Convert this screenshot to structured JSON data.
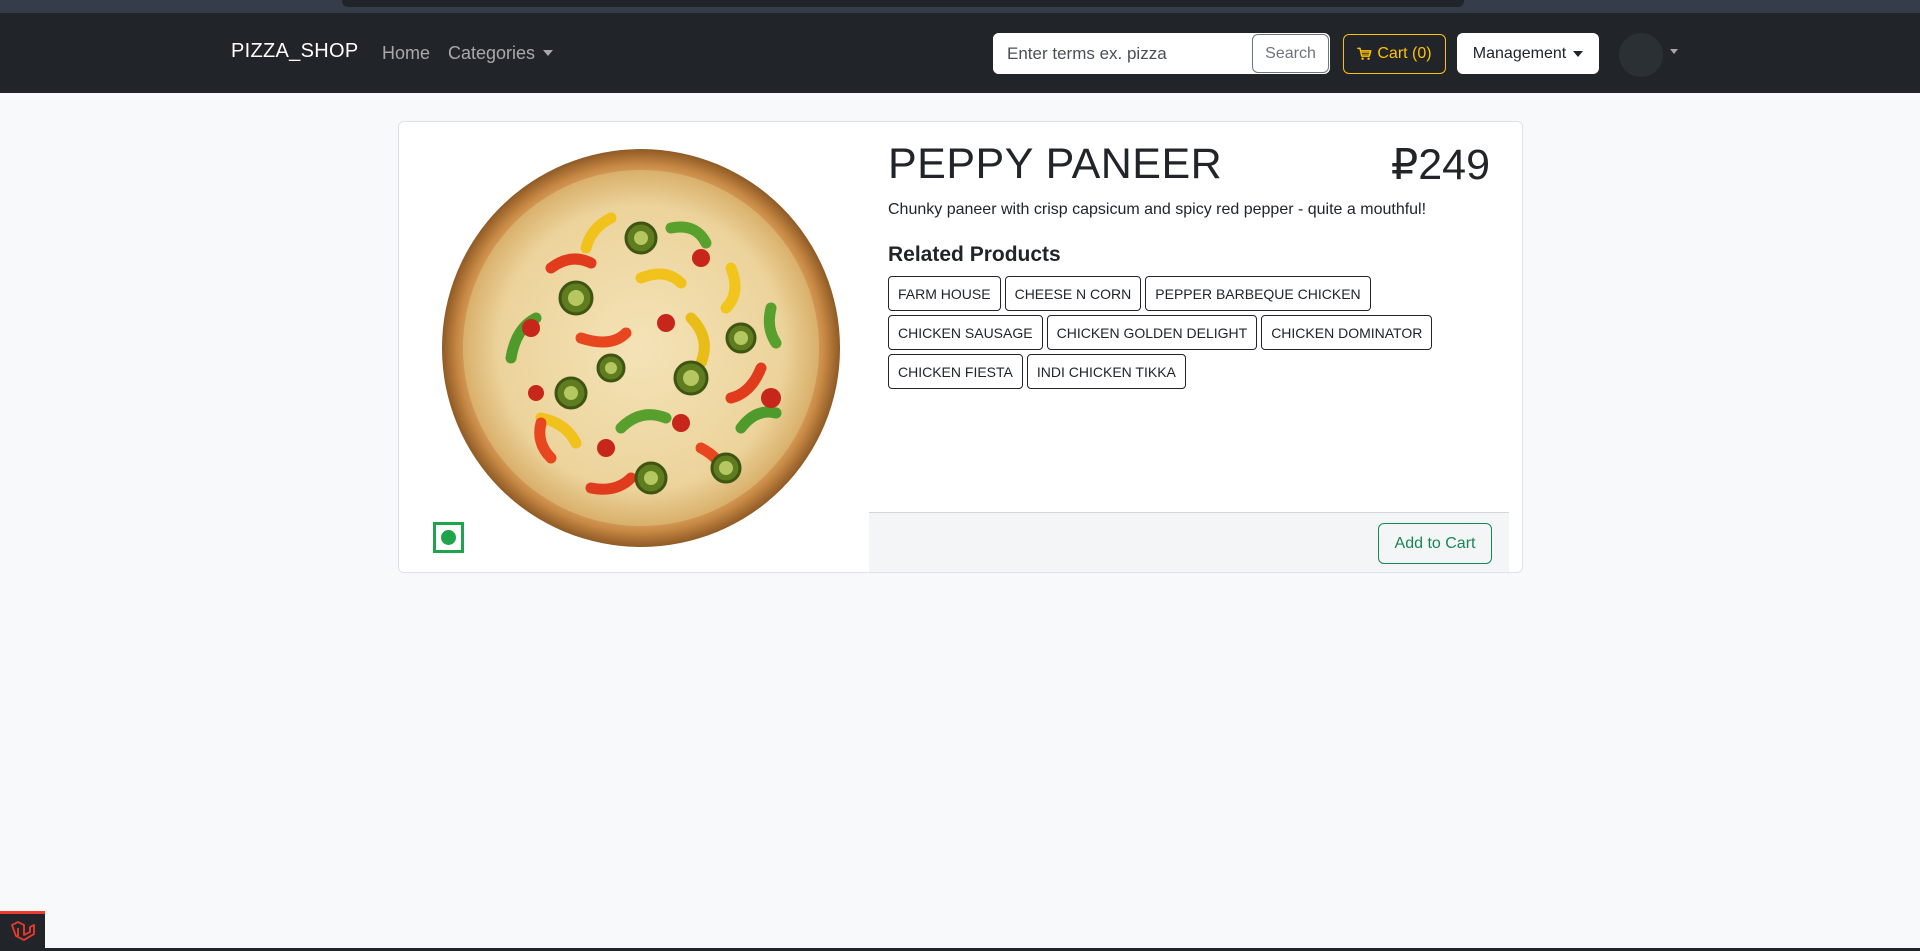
{
  "navbar": {
    "brand": "PIZZA_SHOP",
    "links": {
      "home": "Home",
      "categories": "Categories"
    },
    "search": {
      "placeholder": "Enter terms ex. pizza",
      "value": "",
      "button_label": "Search"
    },
    "cart_label": "Cart (0)",
    "management_label": "Management"
  },
  "product": {
    "name": "PEPPY PANEER",
    "price": "₽249",
    "description": "Chunky paneer with crisp capsicum and spicy red pepper - quite a mouthful!",
    "veg": true,
    "related_heading": "Related Products",
    "related": [
      [
        "FARM HOUSE",
        "CHEESE N CORN",
        "PEPPER BARBEQUE CHICKEN"
      ],
      [
        "CHICKEN SAUSAGE",
        "CHICKEN GOLDEN DELIGHT",
        "CHICKEN DOMINATOR"
      ],
      [
        "CHICKEN FIESTA",
        "INDI CHICKEN TIKKA"
      ]
    ],
    "add_to_cart_label": "Add to Cart"
  },
  "colors": {
    "navbar_bg": "#212529",
    "cart_accent": "#ffc107",
    "add_to_cart_accent": "#198754",
    "veg_mark": "#1ea54b"
  },
  "icons": {
    "cart": "cart-icon",
    "veg": "veg-mark-icon",
    "framework": "framework-logo-icon"
  }
}
